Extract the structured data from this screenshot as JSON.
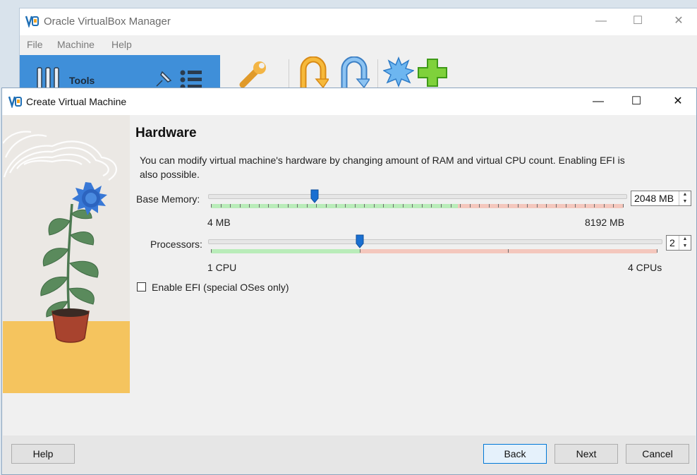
{
  "manager": {
    "title": "Oracle VirtualBox Manager",
    "menu": [
      "File",
      "Machine",
      "Help"
    ],
    "tools_label": "Tools"
  },
  "dialog": {
    "title": "Create Virtual Machine",
    "heading": "Hardware",
    "description": "You can modify virtual machine's hardware by changing amount of RAM and virtual CPU count. Enabling EFI is also possible.",
    "base_memory": {
      "label": "Base Memory:",
      "value": "2048 MB",
      "min_label": "4 MB",
      "max_label": "8192 MB",
      "value_mb": 2048,
      "min_mb": 4,
      "max_mb": 8192
    },
    "processors": {
      "label": "Processors:",
      "value": "2",
      "min_label": "1 CPU",
      "max_label": "4 CPUs",
      "value_cpus": 2,
      "min_cpus": 1,
      "max_cpus": 4
    },
    "efi": {
      "label": "Enable EFI (special OSes only)",
      "checked": false
    },
    "buttons": {
      "help": "Help",
      "back": "Back",
      "next": "Next",
      "cancel": "Cancel"
    }
  },
  "colors": {
    "thumb": "#1a6fd1",
    "scale_green": "#b9ecb9",
    "scale_red": "#f4c7bd",
    "tools_panel": "#3f8fd9"
  }
}
